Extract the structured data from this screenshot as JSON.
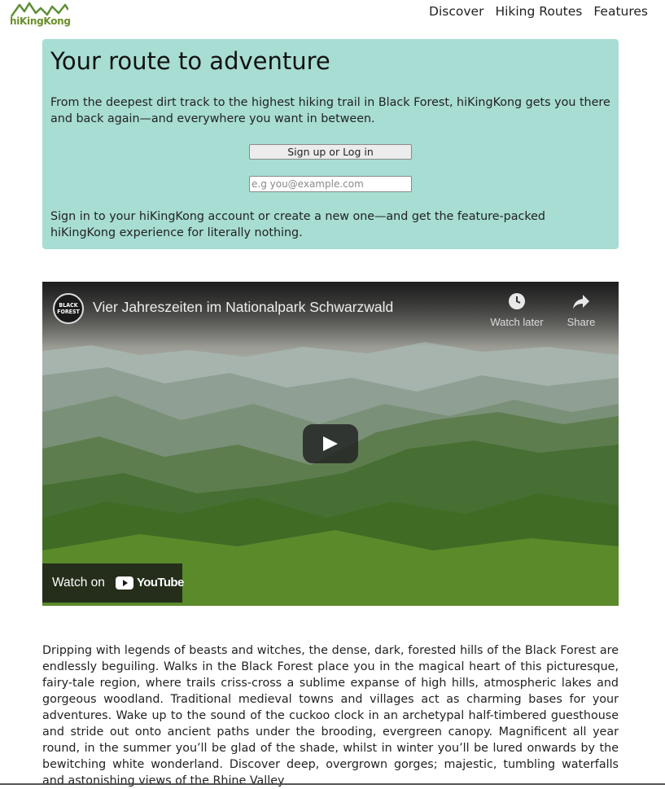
{
  "header": {
    "logo_text": "hiKingKong",
    "nav": [
      {
        "label": "Discover"
      },
      {
        "label": "Hiking Routes"
      },
      {
        "label": "Features"
      }
    ]
  },
  "hero": {
    "title": "Your route to adventure",
    "description": "From the deepest dirt track to the highest hiking trail in Black Forest, hiKingKong gets you there and back again—and everywhere you want in between.",
    "signup_button": "Sign up or Log in",
    "email_placeholder": "e.g you@example.com",
    "note": "Sign in to your hiKingKong account or create a new one—and get the feature-packed hiKingKong experience for literally nothing."
  },
  "video": {
    "channel_logo_text": "BLACK FOREST",
    "title": "Vier Jahreszeiten im Nationalpark Schwarzwald",
    "watch_later_label": "Watch later",
    "share_label": "Share",
    "watch_on_label": "Watch on",
    "youtube_wordmark": "YouTube"
  },
  "article": {
    "text": "Dripping with legends of beasts and witches, the dense, dark, forested hills of the Black Forest are endlessly beguiling. Walks in the Black Forest place you in the magical heart of this picturesque, fairy-tale region, where trails criss-cross a sublime expanse of high hills, atmospheric lakes and gorgeous woodland. Traditional medieval towns and villages act as charming bases for your adventures. Wake up to the sound of the cuckoo clock in an archetypal half-timbered guesthouse and stride out onto ancient paths under the brooding, evergreen canopy. Magnificent all year round, in the summer you’ll be glad of the shade, whilst in winter you’ll be lured onwards by the bewitching white wonderland. Discover deep, overgrown gorges; majestic, tumbling waterfalls and astonishing views of the Rhine Valley"
  },
  "colors": {
    "hero_background": "#a7ddd3",
    "logo_green": "#6b8f2a"
  }
}
